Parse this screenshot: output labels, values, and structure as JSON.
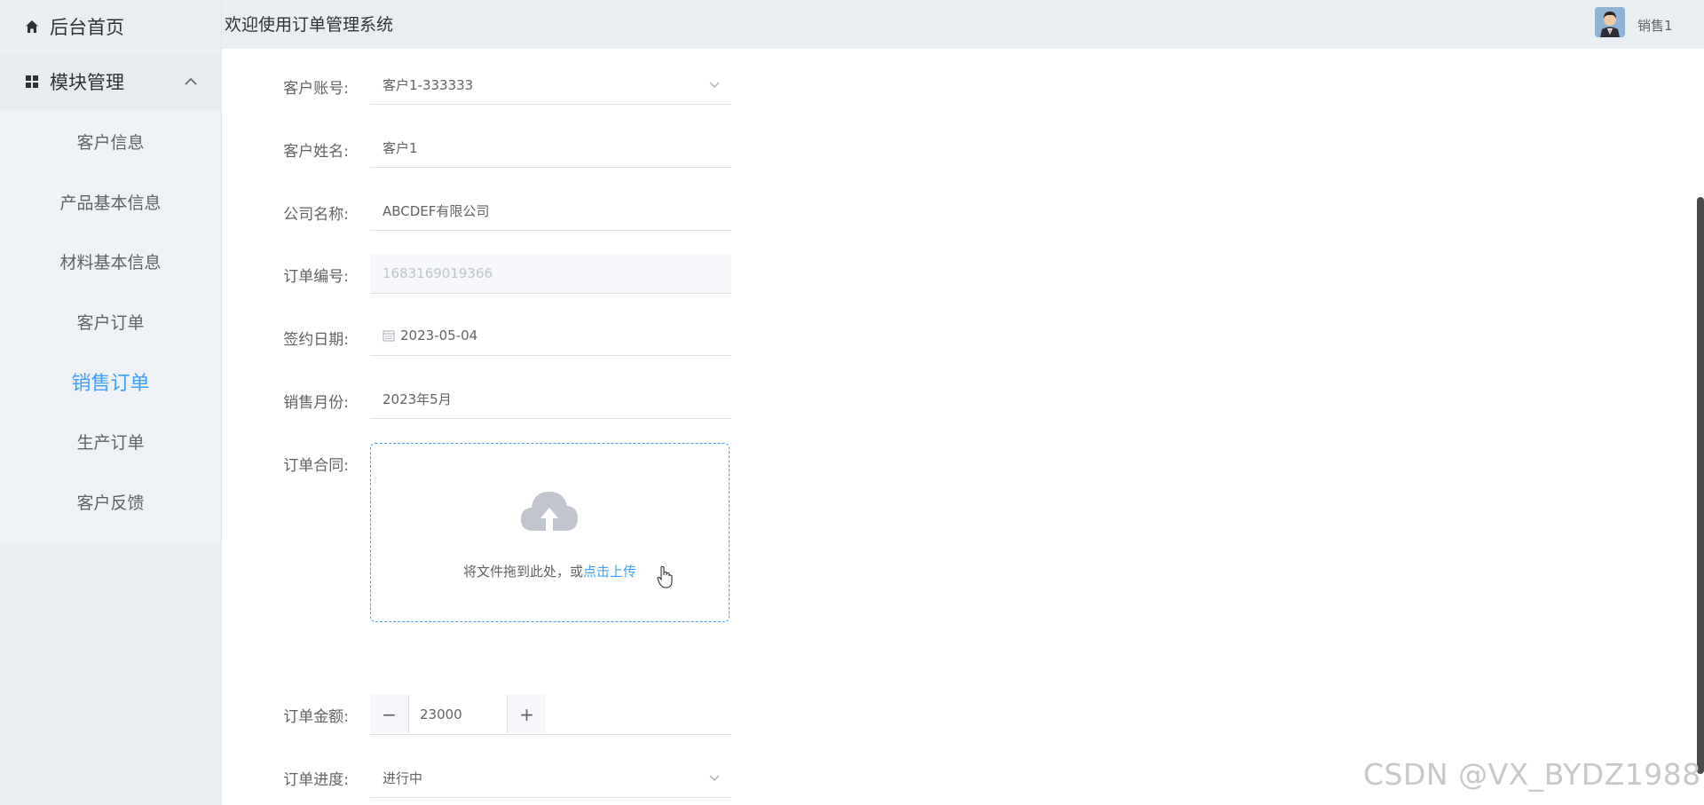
{
  "sidebar": {
    "home_label": "后台首页",
    "module_label": "模块管理",
    "items": [
      {
        "label": "客户信息"
      },
      {
        "label": "产品基本信息"
      },
      {
        "label": "材料基本信息"
      },
      {
        "label": "客户订单"
      },
      {
        "label": "销售订单"
      },
      {
        "label": "生产订单"
      },
      {
        "label": "客户反馈"
      }
    ],
    "active_item": "销售订单"
  },
  "header": {
    "title": "欢迎使用订单管理系统",
    "username": "销售1"
  },
  "form": {
    "customer_account": {
      "label": "客户账号:",
      "value": "客户1-333333"
    },
    "customer_name": {
      "label": "客户姓名:",
      "value": "客户1"
    },
    "company_name": {
      "label": "公司名称:",
      "value": "ABCDEF有限公司"
    },
    "order_number": {
      "label": "订单编号:",
      "value": "1683169019366"
    },
    "sign_date": {
      "label": "签约日期:",
      "value": "2023-05-04"
    },
    "sales_month": {
      "label": "销售月份:",
      "value": "2023年5月"
    },
    "contract": {
      "label": "订单合同:",
      "hint": "将文件拖到此处，或",
      "link": "点击上传"
    },
    "order_amount": {
      "label": "订单金额:",
      "value": "23000",
      "minus": "−",
      "plus": "+"
    },
    "order_progress": {
      "label": "订单进度:",
      "value": "进行中"
    }
  },
  "watermark": "CSDN @VX_BYDZ1988",
  "colors": {
    "accent": "#409eff",
    "sidebar_bg": "#e9eef3",
    "text": "#606266"
  }
}
